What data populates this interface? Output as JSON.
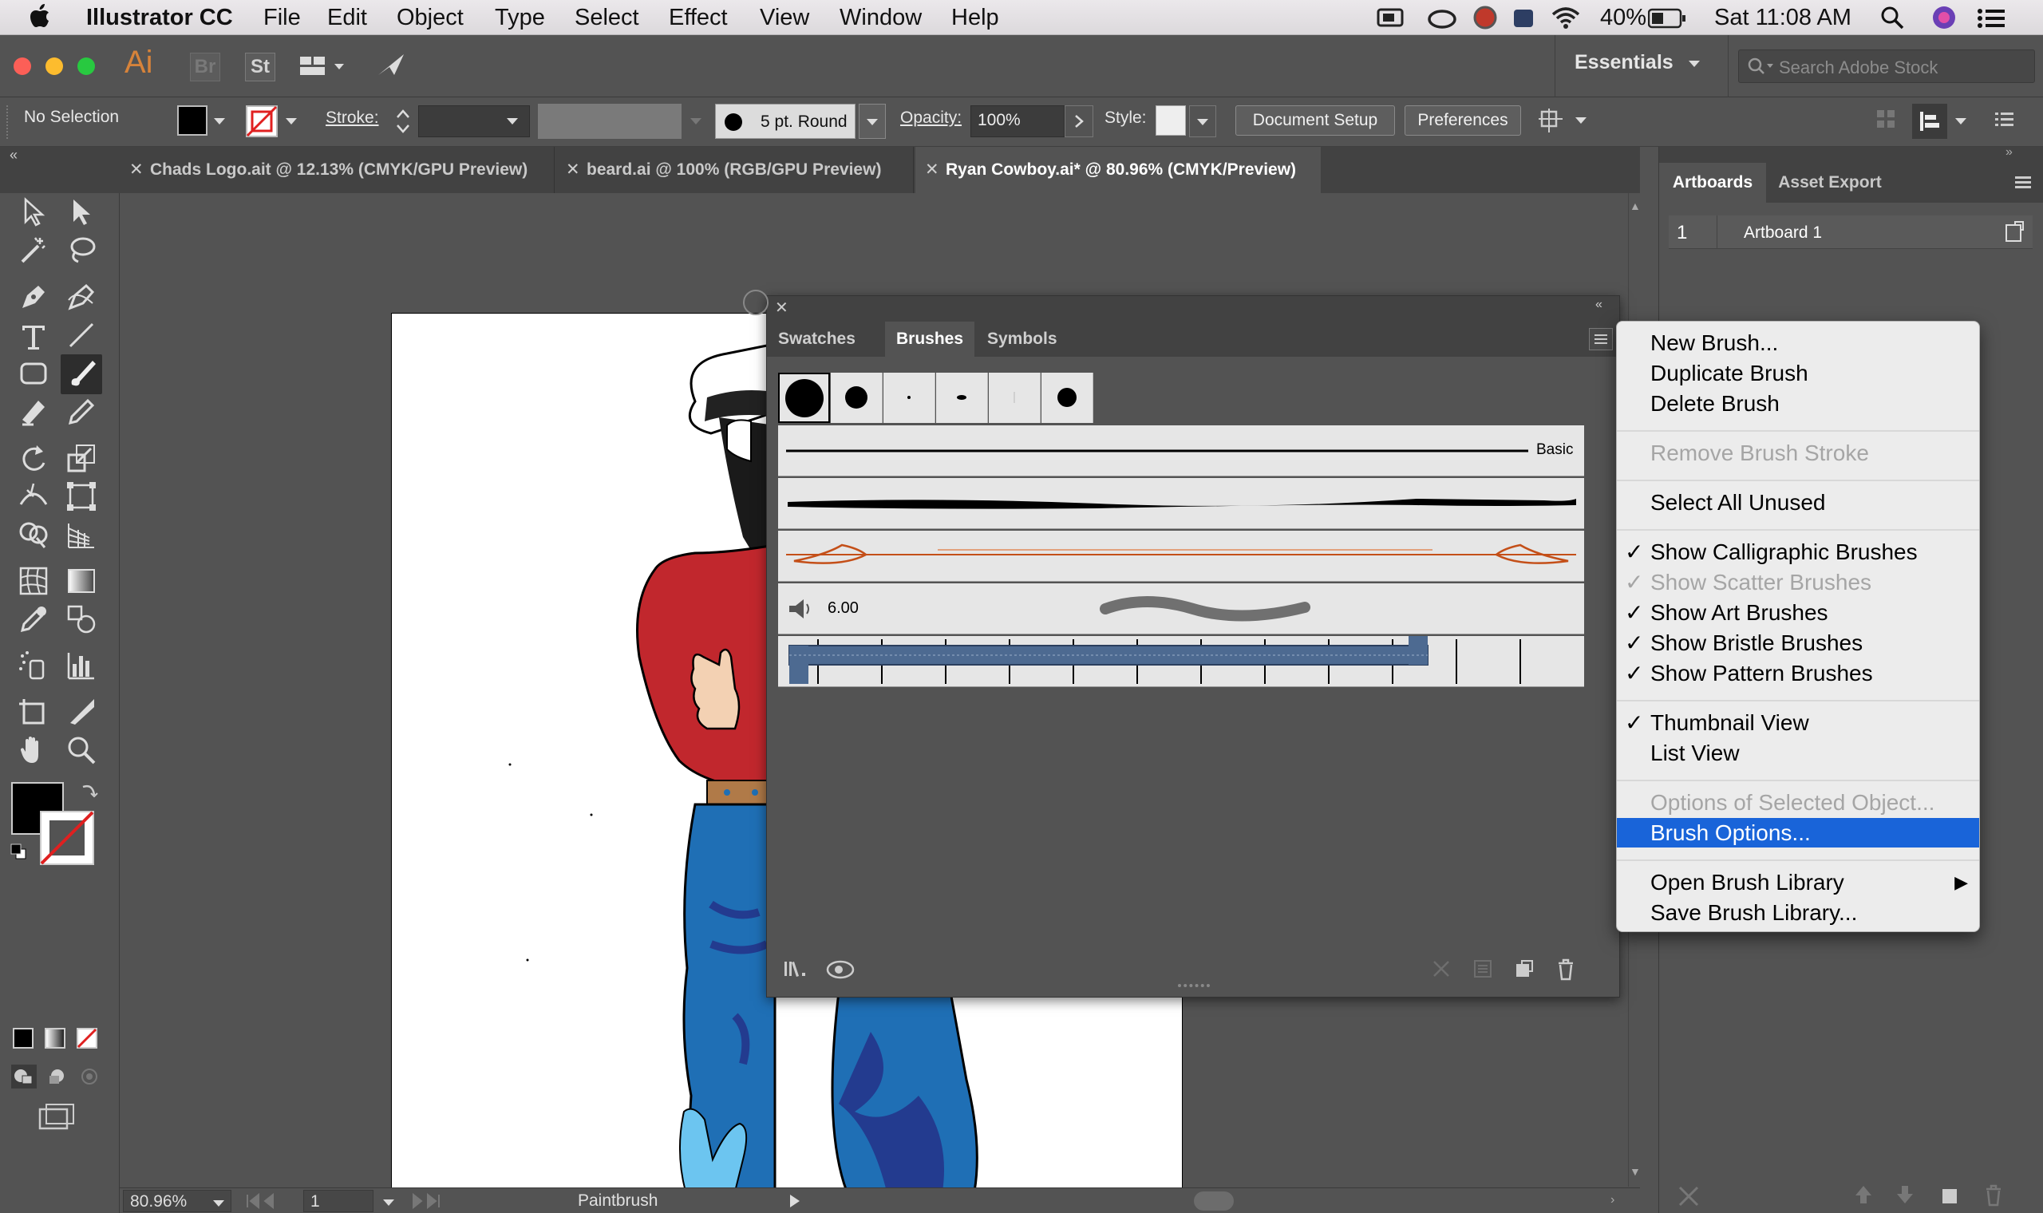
{
  "menubar": {
    "app_name": "Illustrator CC",
    "items": [
      "File",
      "Edit",
      "Object",
      "Type",
      "Select",
      "Effect",
      "View",
      "Window",
      "Help"
    ],
    "battery": "40%",
    "clock": "Sat 11:08 AM"
  },
  "appbar": {
    "logo": "Ai",
    "bridge": "Br",
    "stock": "St",
    "workspace": "Essentials",
    "search_placeholder": "Search Adobe Stock"
  },
  "control_bar": {
    "selection_label": "No Selection",
    "stroke_label": "Stroke:",
    "brush_def": "5 pt. Round",
    "opacity_label": "Opacity:",
    "opacity_value": "100%",
    "style_label": "Style:",
    "document_setup": "Document Setup",
    "preferences": "Preferences"
  },
  "tabs": [
    {
      "label": "Chads Logo.ait @ 12.13% (CMYK/GPU Preview)"
    },
    {
      "label": "beard.ai @ 100% (RGB/GPU Preview)"
    },
    {
      "label": "Ryan Cowboy.ai* @ 80.96% (CMYK/Preview)"
    }
  ],
  "right_panel": {
    "tabs": [
      "Artboards",
      "Asset Export"
    ],
    "artboard_number": "1",
    "artboard_name": "Artboard 1"
  },
  "brushes_panel": {
    "tabs": [
      "Swatches",
      "Brushes",
      "Symbols"
    ],
    "basic_label": "Basic",
    "bristle_size": "6.00"
  },
  "context_menu": {
    "items": [
      {
        "label": "New Brush...",
        "checked": false,
        "disabled": false,
        "highlight": false
      },
      {
        "label": "Duplicate Brush",
        "checked": false,
        "disabled": false,
        "highlight": false
      },
      {
        "label": "Delete Brush",
        "checked": false,
        "disabled": false,
        "highlight": false
      },
      {
        "label": "Remove Brush Stroke",
        "checked": false,
        "disabled": true,
        "highlight": false
      },
      {
        "label": "Select All Unused",
        "checked": false,
        "disabled": false,
        "highlight": false
      },
      {
        "label": "Show Calligraphic Brushes",
        "checked": true,
        "disabled": false,
        "highlight": false
      },
      {
        "label": "Show Scatter Brushes",
        "checked": true,
        "disabled": true,
        "highlight": false
      },
      {
        "label": "Show Art Brushes",
        "checked": true,
        "disabled": false,
        "highlight": false
      },
      {
        "label": "Show Bristle Brushes",
        "checked": true,
        "disabled": false,
        "highlight": false
      },
      {
        "label": "Show Pattern Brushes",
        "checked": true,
        "disabled": false,
        "highlight": false
      },
      {
        "label": "Thumbnail View",
        "checked": true,
        "disabled": false,
        "highlight": false
      },
      {
        "label": "List View",
        "checked": false,
        "disabled": false,
        "highlight": false
      },
      {
        "label": "Options of Selected Object...",
        "checked": false,
        "disabled": true,
        "highlight": false
      },
      {
        "label": "Brush Options...",
        "checked": false,
        "disabled": false,
        "highlight": true
      },
      {
        "label": "Open Brush Library",
        "checked": false,
        "disabled": false,
        "highlight": false
      },
      {
        "label": "Save Brush Library...",
        "checked": false,
        "disabled": false,
        "highlight": false
      }
    ],
    "checkmark": "✓",
    "submenu_arrow": "▶"
  },
  "status_bar": {
    "zoom": "80.96%",
    "artboard_index": "1",
    "current_tool": "Paintbrush"
  },
  "colors": {
    "accent_highlight": "#1964d9",
    "ui_bg": "#535353",
    "shirt_red": "#c1272d",
    "jeans_blue": "#1f6fb5",
    "boot_light_blue": "#6cc5f0"
  }
}
